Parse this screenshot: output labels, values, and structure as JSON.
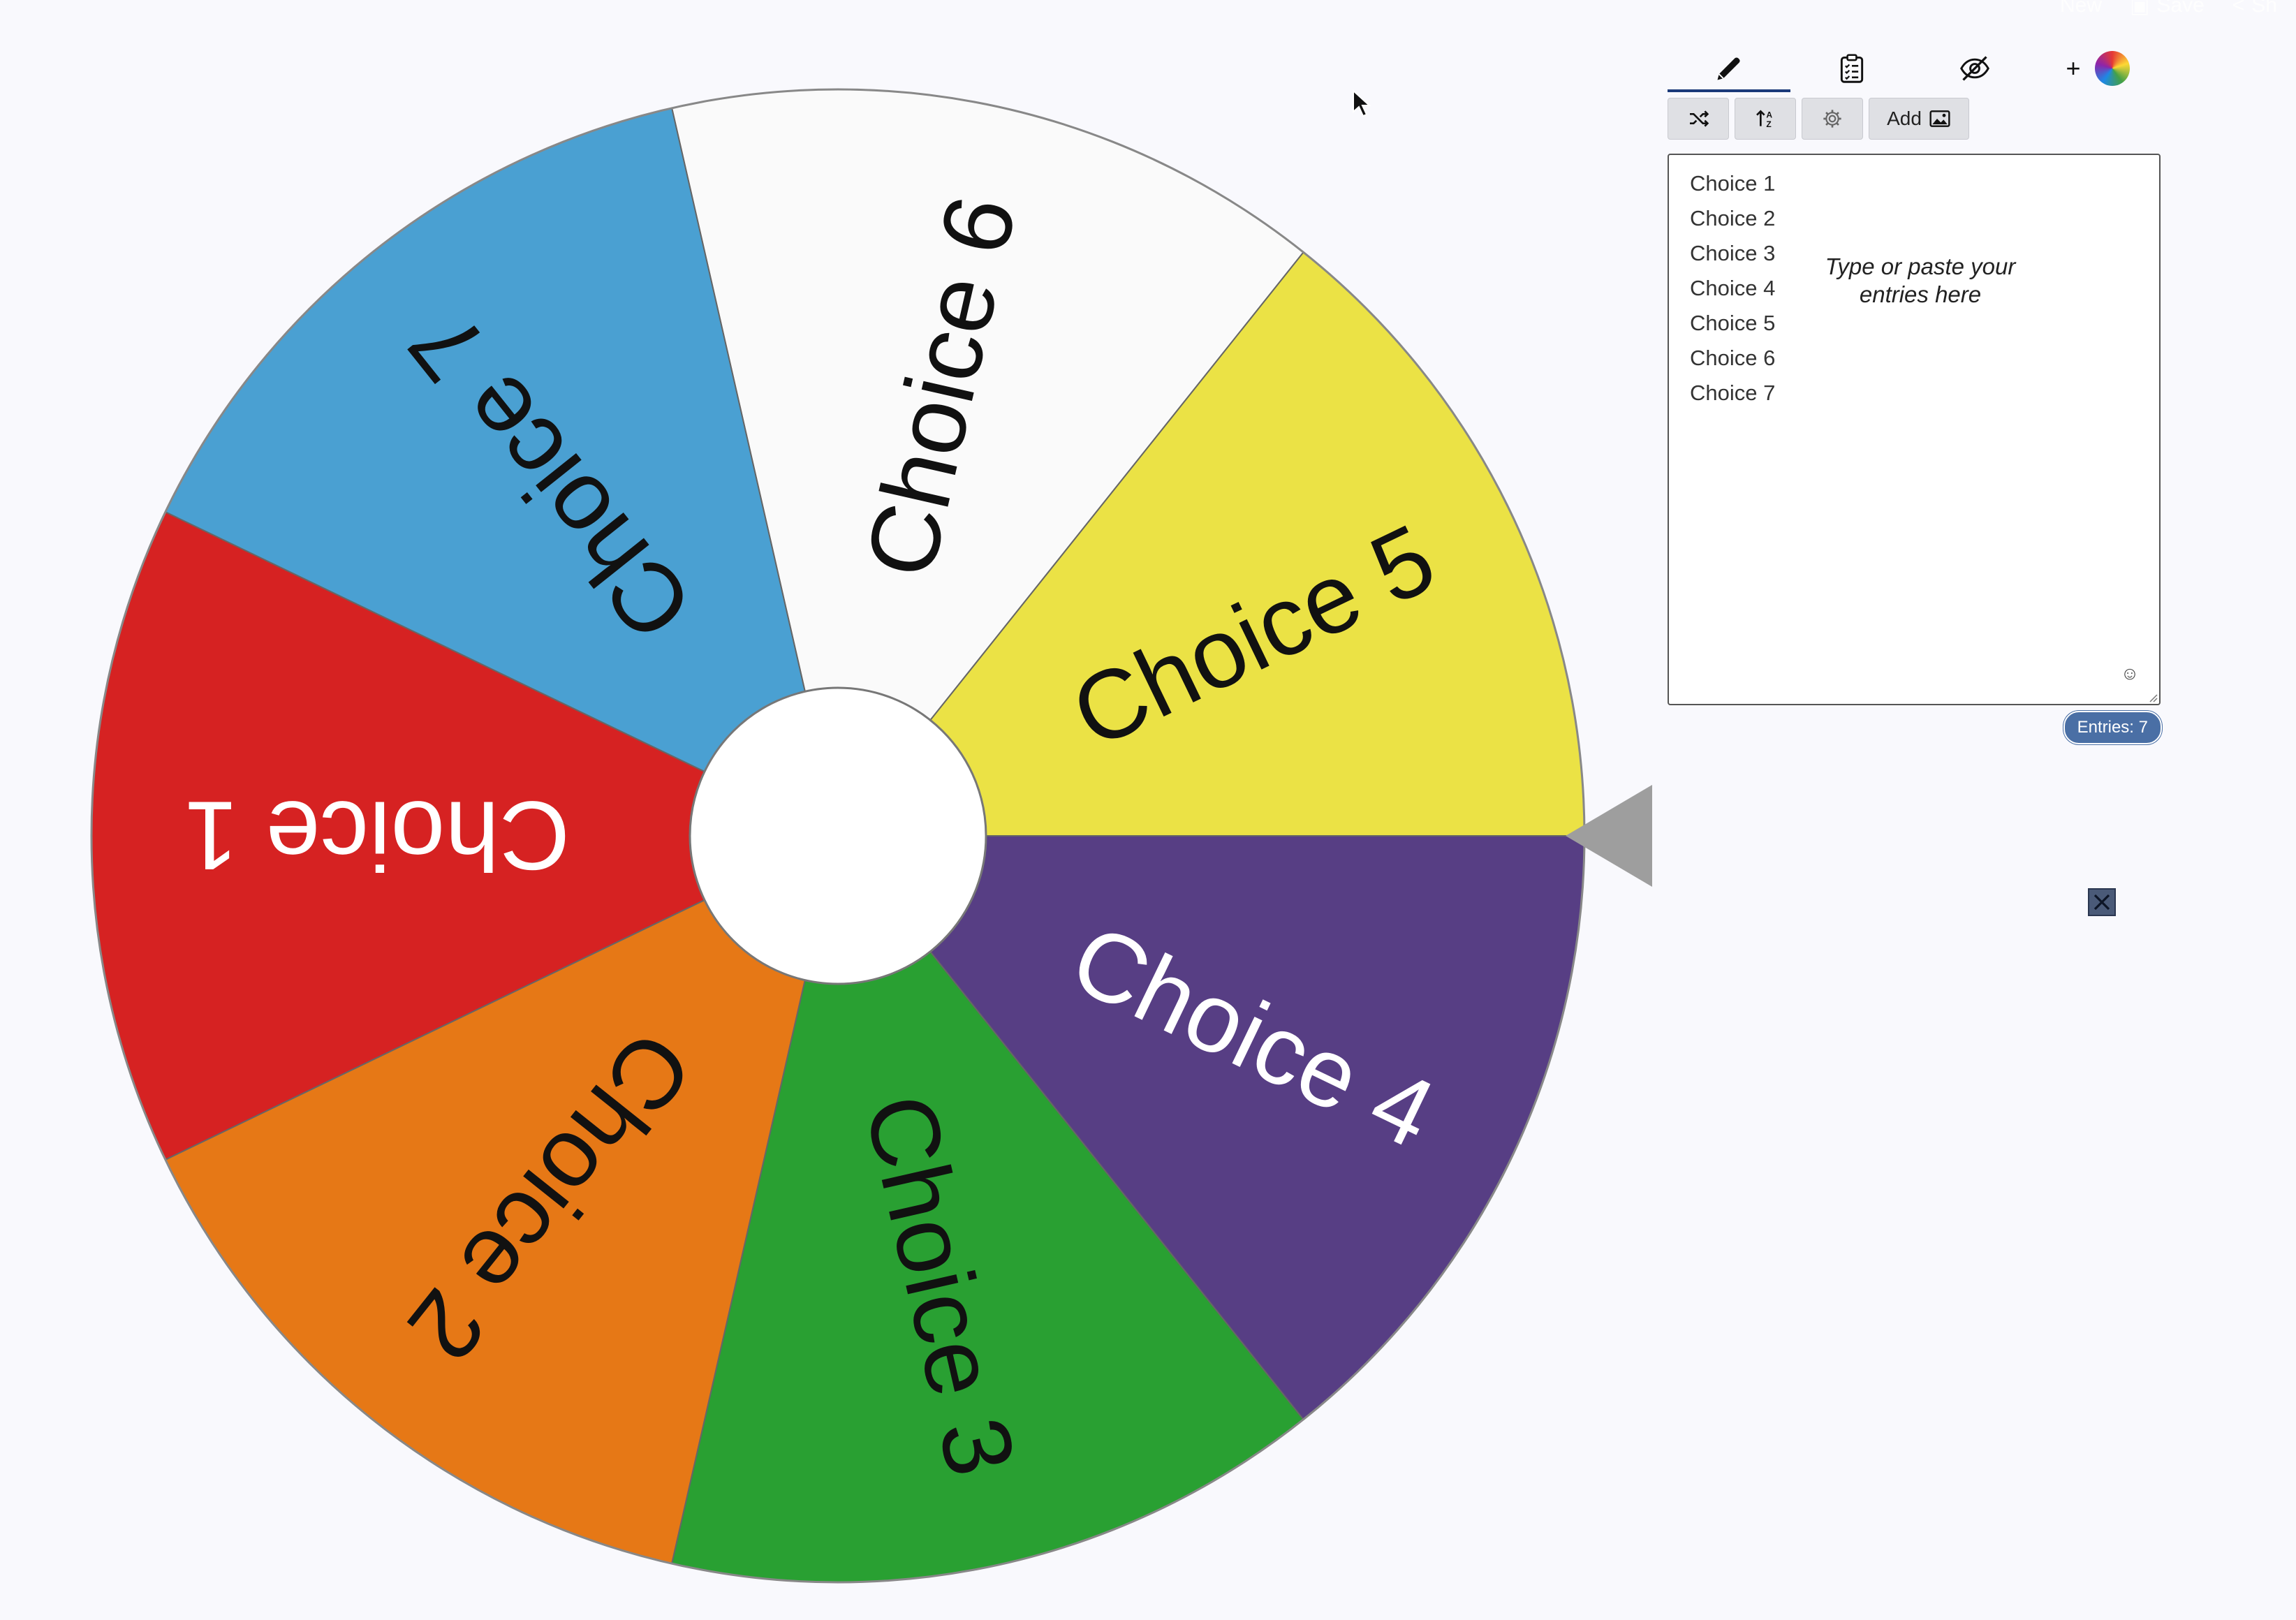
{
  "topbar": {
    "new_label": "New",
    "save_label": "Save",
    "share_label": "Sh"
  },
  "wheel": {
    "segments": [
      {
        "label": "Choice 1",
        "color": "#d62222",
        "text_color": "#ffffff"
      },
      {
        "label": "Choice 2",
        "color": "#e67816",
        "text_color": "#111111"
      },
      {
        "label": "Choice 3",
        "color": "#29a032",
        "text_color": "#111111"
      },
      {
        "label": "Choice 4",
        "color": "#573e84",
        "text_color": "#ffffff"
      },
      {
        "label": "Choice 5",
        "color": "#ebe245",
        "text_color": "#111111"
      },
      {
        "label": "Choice 6",
        "color": "#fafafa",
        "text_color": "#111111"
      },
      {
        "label": "Choice 7",
        "color": "#4aa0d2",
        "text_color": "#111111"
      }
    ]
  },
  "tabs": {
    "icons": [
      "pencil-icon",
      "clipboard-list-icon",
      "eye-slash-icon"
    ],
    "plus_label": "+"
  },
  "toolbar": {
    "shuffle_icon": "shuffle-icon",
    "sort_icon": "sort-icon",
    "settings_icon": "gear-icon",
    "add_image_label": "Add"
  },
  "entries": {
    "items": [
      "Choice 1",
      "Choice 2",
      "Choice 3",
      "Choice 4",
      "Choice 5",
      "Choice 6",
      "Choice 7"
    ],
    "placeholder": "Type or paste your entries here",
    "count_label": "Entries: 7"
  },
  "colors": {
    "accent": "#1b3a7a",
    "badge": "#4a6fa5",
    "pointer": "#9e9e9e"
  }
}
